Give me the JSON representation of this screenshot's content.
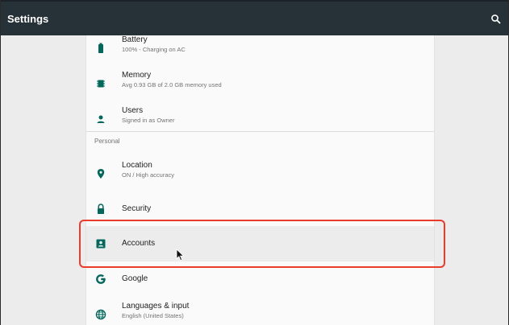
{
  "app": {
    "title": "Settings",
    "search_icon": "search-icon"
  },
  "colors": {
    "appbar": "#263238",
    "accent": "#00695c",
    "highlight": "#ec3b2a"
  },
  "device_items": [
    {
      "title": "Battery",
      "subtitle": "100% - Charging on AC",
      "icon": "battery-icon"
    },
    {
      "title": "Memory",
      "subtitle": "Avg 0.93 GB of 2.0 GB memory used",
      "icon": "memory-icon"
    },
    {
      "title": "Users",
      "subtitle": "Signed in as Owner",
      "icon": "person-icon"
    }
  ],
  "personal": {
    "header": "Personal",
    "items": [
      {
        "title": "Location",
        "subtitle": "ON / High accuracy",
        "icon": "location-pin-icon"
      },
      {
        "title": "Security",
        "icon": "lock-icon"
      },
      {
        "title": "Accounts",
        "icon": "account-box-icon"
      },
      {
        "title": "Google",
        "icon": "google-icon"
      },
      {
        "title": "Languages & input",
        "subtitle": "English (United States)",
        "icon": "globe-icon"
      }
    ]
  }
}
